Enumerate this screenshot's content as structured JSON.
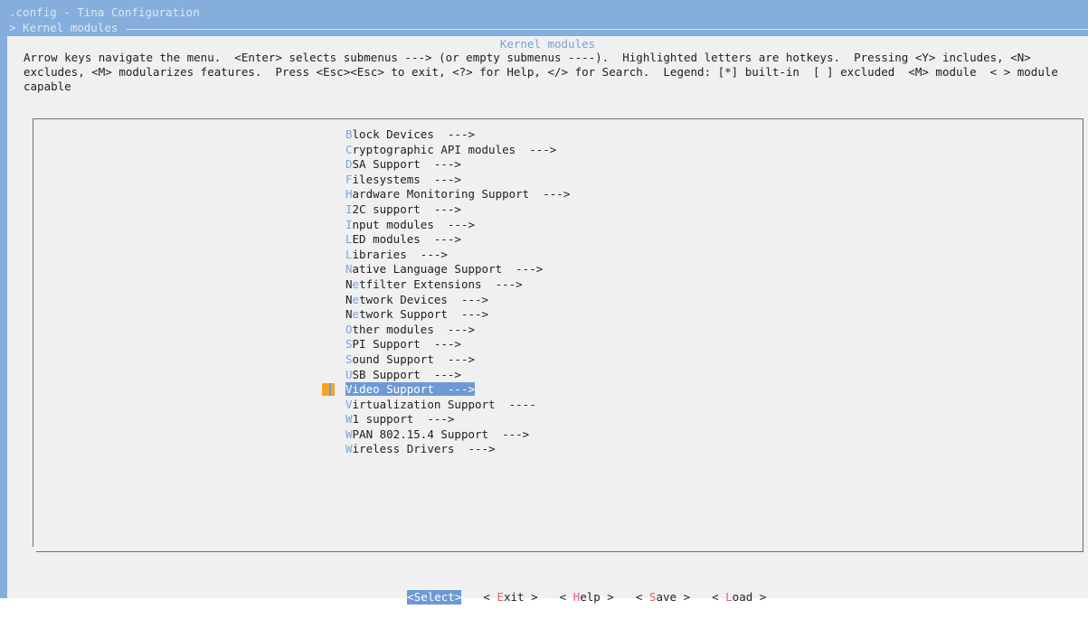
{
  "window": {
    "title_line": ".config - Tina Configuration",
    "breadcrumb": "> Kernel modules"
  },
  "dialog": {
    "title": "Kernel modules",
    "help_text": "Arrow keys navigate the menu.  <Enter> selects submenus ---> (or empty submenus ----).  Highlighted letters are hotkeys.  Pressing <Y> includes, <N> excludes, <M> modularizes features.  Press <Esc><Esc> to exit, <?> for Help, </> for Search.  Legend: [*] built-in  [ ] excluded  <M> module  < > module capable"
  },
  "menu": {
    "items": [
      {
        "hotkey": "B",
        "rest": "lock Devices  --->"
      },
      {
        "hotkey": "C",
        "rest": "ryptographic API modules  --->"
      },
      {
        "hotkey": "D",
        "rest": "SA Support  --->"
      },
      {
        "hotkey": "F",
        "rest": "ilesystems  --->"
      },
      {
        "hotkey": "H",
        "rest": "ardware Monitoring Support  --->"
      },
      {
        "hotkey": "I",
        "rest": "2C support  --->"
      },
      {
        "hotkey": "I",
        "rest": "nput modules  --->"
      },
      {
        "hotkey": "L",
        "rest": "ED modules  --->"
      },
      {
        "hotkey": "L",
        "rest": "ibraries  --->"
      },
      {
        "hotkey": "N",
        "rest": "ative Language Support  --->"
      },
      {
        "pre": "N",
        "hotkey": "e",
        "rest": "tfilter Extensions  --->"
      },
      {
        "pre": "N",
        "hotkey": "e",
        "rest": "twork Devices  --->"
      },
      {
        "pre": "N",
        "hotkey": "e",
        "rest": "twork Support  --->"
      },
      {
        "hotkey": "O",
        "rest": "ther modules  --->"
      },
      {
        "hotkey": "S",
        "rest": "PI Support  --->"
      },
      {
        "hotkey": "S",
        "rest": "ound Support  --->"
      },
      {
        "hotkey": "U",
        "rest": "SB Support  --->"
      },
      {
        "hotkey": "V",
        "rest": "ideo Support  --->",
        "selected": true
      },
      {
        "hotkey": "V",
        "rest": "irtualization Support  ----"
      },
      {
        "hotkey": "W",
        "rest": "1 support  --->"
      },
      {
        "hotkey": "W",
        "rest": "PAN 802.15.4 Support  --->"
      },
      {
        "hotkey": "W",
        "rest": "ireless Drivers  --->"
      }
    ]
  },
  "buttons": {
    "select": "<Select>",
    "exit": {
      "pre": "< ",
      "hotkey": "E",
      "rest": "xit >"
    },
    "help": {
      "pre": "< ",
      "hotkey": "H",
      "rest": "elp >"
    },
    "save": {
      "pre": "< ",
      "hotkey": "S",
      "rest": "ave >"
    },
    "load": {
      "pre": "< ",
      "hotkey": "L",
      "rest": "oad >"
    }
  },
  "colors": {
    "background": "#85aedc",
    "dialog": "#f0f0f0",
    "hotkey": "#7fa4d8",
    "selection": "#6d9ad6",
    "button_hotkey": "#e0606a",
    "cursor": "#f5a623"
  }
}
